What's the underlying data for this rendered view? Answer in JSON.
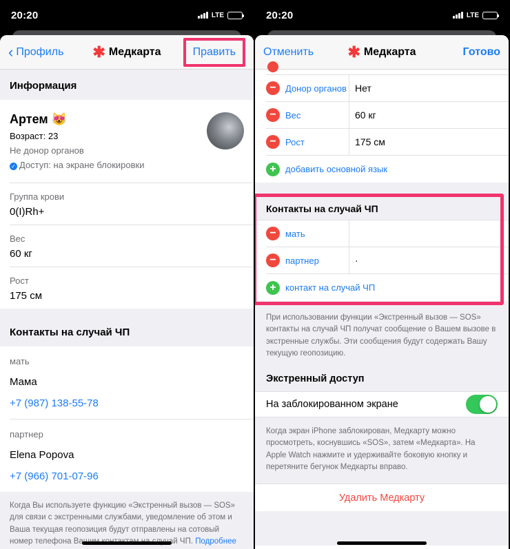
{
  "left": {
    "status": {
      "time": "20:20",
      "network": "LTE"
    },
    "nav": {
      "back": "Профиль",
      "title": "Медкарта",
      "edit": "Править"
    },
    "info_header": "Информация",
    "profile": {
      "name": "Артем 😻",
      "age": "Возраст: 23",
      "donor": "Не донор органов",
      "access": "Доступ: на экране блокировки"
    },
    "fields": [
      {
        "label": "Группа крови",
        "value": "0(I)Rh+"
      },
      {
        "label": "Вес",
        "value": "60 кг"
      },
      {
        "label": "Рост",
        "value": "175 см"
      }
    ],
    "contacts_header": "Контакты на случай ЧП",
    "contacts": [
      {
        "role": "мать",
        "name": "Мама",
        "phone": "+7 (987) 138-55-78"
      },
      {
        "role": "партнер",
        "name": "Elena Popova",
        "phone": "+7 (966) 701-07-96"
      }
    ],
    "footnote": "Когда Вы используете функцию «Экстренный вызов — SOS» для связи с экстренными службами, уведомление об этом и Ваша текущая геопозиция будут отправлены на сотовый номер телефона Вашим контактам на случай ЧП.",
    "footnote_link": "Подробнее об Экстренном вызове — SOS…"
  },
  "right": {
    "status": {
      "time": "20:20",
      "network": "LTE"
    },
    "nav": {
      "cancel": "Отменить",
      "title": "Медкарта",
      "done": "Готово"
    },
    "rows": [
      {
        "key": "Донор органов",
        "value": "Нет"
      },
      {
        "key": "Вес",
        "value": "60 кг"
      },
      {
        "key": "Рост",
        "value": "175 см"
      }
    ],
    "add_language": "добавить основной язык",
    "contacts_header": "Контакты на случай ЧП",
    "contacts": [
      {
        "key": "мать",
        "value": ""
      },
      {
        "key": "партнер",
        "value": "·"
      }
    ],
    "add_contact": "контакт на случай ЧП",
    "sos_desc": "При использовании функции «Экстренный вызов — SOS» контакты на случай ЧП получат сообщение о Вашем вызове в экстренные службы. Эти сообщения будут содержать Вашу текущую геопозицию.",
    "emergency_header": "Экстренный доступ",
    "lock_screen_label": "На заблокированном экране",
    "lock_screen_enabled": true,
    "lock_desc": "Когда экран iPhone заблокирован, Медкарту можно просмотреть, коснувшись «SOS», затем «Медкарта». На Apple Watch нажмите и удерживайте боковую кнопку и перетяните бегунок Медкарты вправо.",
    "delete": "Удалить Медкарту"
  },
  "colors": {
    "accent": "#1a7cf4",
    "highlight": "#f0346d",
    "destructive": "#f0483e",
    "positive": "#34c759"
  }
}
